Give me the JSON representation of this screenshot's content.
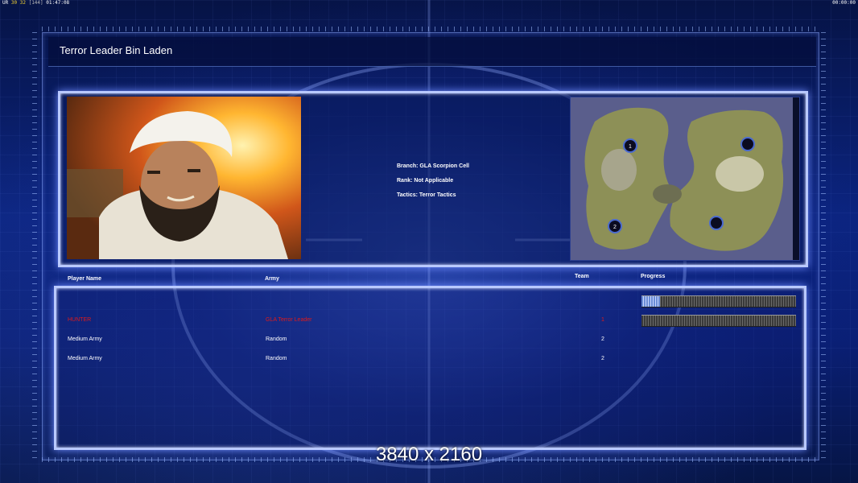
{
  "hud": {
    "top_left_1": "UR",
    "top_left_2": "30",
    "top_left_3": "32",
    "top_left_4": "[144]",
    "top_left_5": "01:47:08",
    "top_right": "00:00:00"
  },
  "title": "Terror Leader Bin Laden",
  "general": {
    "branch": "Branch: GLA Scorpion Cell",
    "rank": "Rank: Not Applicable",
    "tactics": "Tactics: Terror Tactics"
  },
  "map": {
    "start_positions": [
      {
        "label": "1"
      },
      {
        "label": ""
      },
      {
        "label": "2"
      },
      {
        "label": ""
      }
    ]
  },
  "table": {
    "headers": {
      "player": "Player Name",
      "army": "Army",
      "team": "Team",
      "progress": "Progress"
    },
    "rows": [
      {
        "player": "",
        "army": "",
        "team": "",
        "color": "#2e3fe6",
        "progress": 0.12
      },
      {
        "player": "HUNTER",
        "army": "GLA Terror Leader",
        "team": "1",
        "color": "#e01a1a",
        "progress": 0.0
      },
      {
        "player": "Medium Army",
        "army": "Random",
        "team": "2",
        "color": "#ffffff"
      },
      {
        "player": "Medium Army",
        "army": "Random",
        "team": "2",
        "color": "#ffffff"
      }
    ]
  },
  "resolution_text": "3840 x 2160",
  "colors": {
    "frame_glow": "#b9c9ff",
    "background": "#0b2480"
  }
}
